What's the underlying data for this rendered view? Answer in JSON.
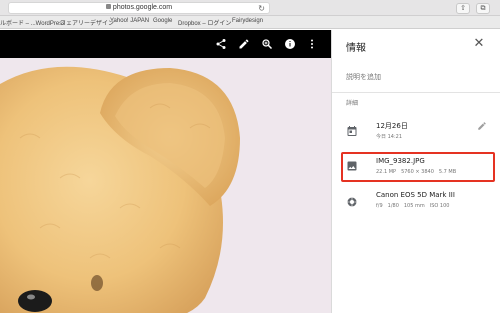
{
  "browser": {
    "url": "photos.google.com",
    "bookmarks": [
      "ルボード – ...WordPress",
      "フェアリーデザイン",
      "Yahoo! JAPAN",
      "Google",
      "Dropbox – ログイン",
      "Fairydesign"
    ]
  },
  "panel": {
    "title": "情報",
    "description_placeholder": "説明を追加",
    "section_label": "詳細",
    "date": {
      "main": "12月26日",
      "sub": "今日 14:21"
    },
    "file": {
      "name": "IMG_9382.JPG",
      "megapixels": "22.1 MP",
      "resolution": "5760 × 3840",
      "size": "5.7 MB"
    },
    "camera": {
      "model": "Canon EOS 5D Mark III",
      "aperture": "f/9",
      "shutter": "1/80",
      "focal": "105 mm",
      "iso": "ISO 100"
    }
  },
  "colors": {
    "highlight": "#e53222",
    "toolbar": "#000000"
  },
  "icons": [
    "share-icon",
    "edit-icon",
    "zoom-icon",
    "info-icon",
    "more-vert-icon",
    "close-icon",
    "calendar-icon",
    "image-icon",
    "camera-icon",
    "pencil-icon"
  ]
}
